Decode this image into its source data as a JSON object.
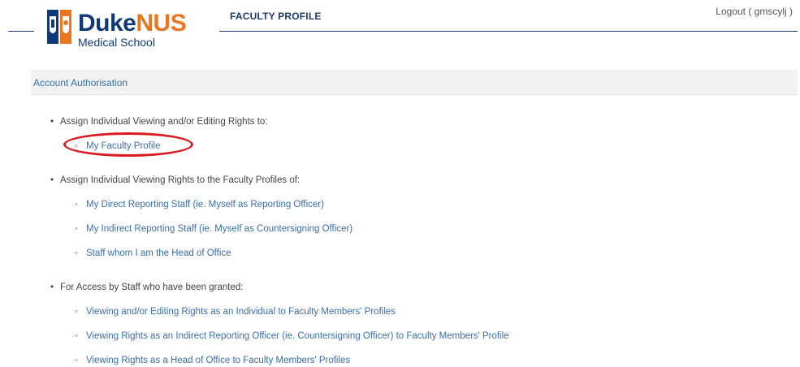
{
  "header": {
    "logo_brand_duke": "Duke",
    "logo_brand_nus": "NUS",
    "logo_sub": "Medical School",
    "app_title": "FACULTY PROFILE",
    "logout_label": "Logout ( gmscylj )"
  },
  "section": {
    "title": "Account Authorisation"
  },
  "groups": [
    {
      "label": "Assign Individual Viewing and/or Editing Rights to:",
      "items": [
        {
          "label": "My Faculty Profile"
        }
      ]
    },
    {
      "label": "Assign Individual Viewing Rights to the Faculty Profiles of:",
      "items": [
        {
          "label": "My Direct Reporting Staff (ie. Myself as Reporting Officer)"
        },
        {
          "label": "My Indirect Reporting Staff (ie. Myself as Countersigning Officer)"
        },
        {
          "label": "Staff whom I am the Head of Office"
        }
      ]
    },
    {
      "label": "For Access by Staff who have been granted:",
      "items": [
        {
          "label": "Viewing and/or Editing Rights as an Individual to Faculty Members' Profiles"
        },
        {
          "label": "Viewing Rights as an Indirect Reporting Officer (ie. Countersigning Officer) to Faculty Members' Profile"
        },
        {
          "label": "Viewing Rights as a Head of Office to Faculty Members' Profiles"
        }
      ]
    }
  ],
  "colors": {
    "brand_blue": "#0e3a78",
    "brand_orange": "#e87722",
    "link_blue": "#3a6ea5",
    "highlight_red": "#d81b21"
  }
}
